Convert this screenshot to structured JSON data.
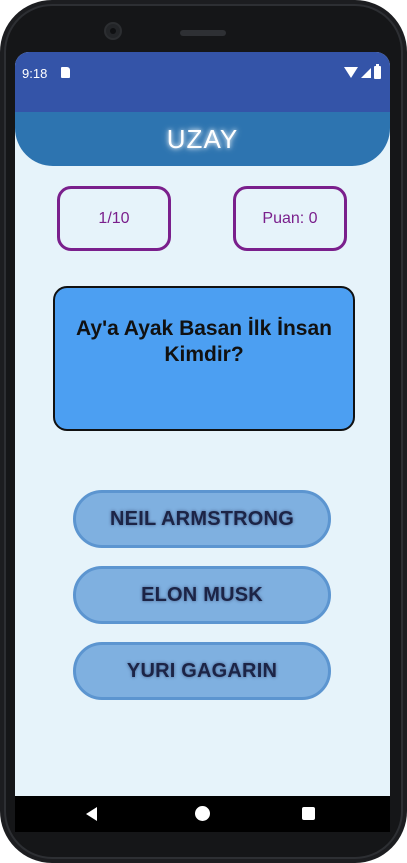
{
  "status_bar": {
    "time": "9:18",
    "icons": [
      "sd-card-icon",
      "wifi-icon",
      "signal-icon",
      "battery-icon"
    ]
  },
  "header": {
    "title": "UZAY"
  },
  "counters": {
    "question_progress": "1/10",
    "score": "Puan: 0"
  },
  "question": {
    "text": "Ay'a Ayak Basan İlk İnsan Kimdir?"
  },
  "answers": [
    {
      "label": "NEIL ARMSTRONG"
    },
    {
      "label": "ELON MUSK"
    },
    {
      "label": "YURI GAGARIN"
    }
  ],
  "nav": {
    "icons": [
      "back-icon",
      "home-icon",
      "recents-icon"
    ]
  },
  "colors": {
    "status_bar": "#3454a8",
    "header": "#2d74b0",
    "background": "#e6f3fa",
    "counter_border": "#7a1f8c",
    "question_card": "#4c9ff2",
    "answer_button": "#7fb0e0"
  }
}
